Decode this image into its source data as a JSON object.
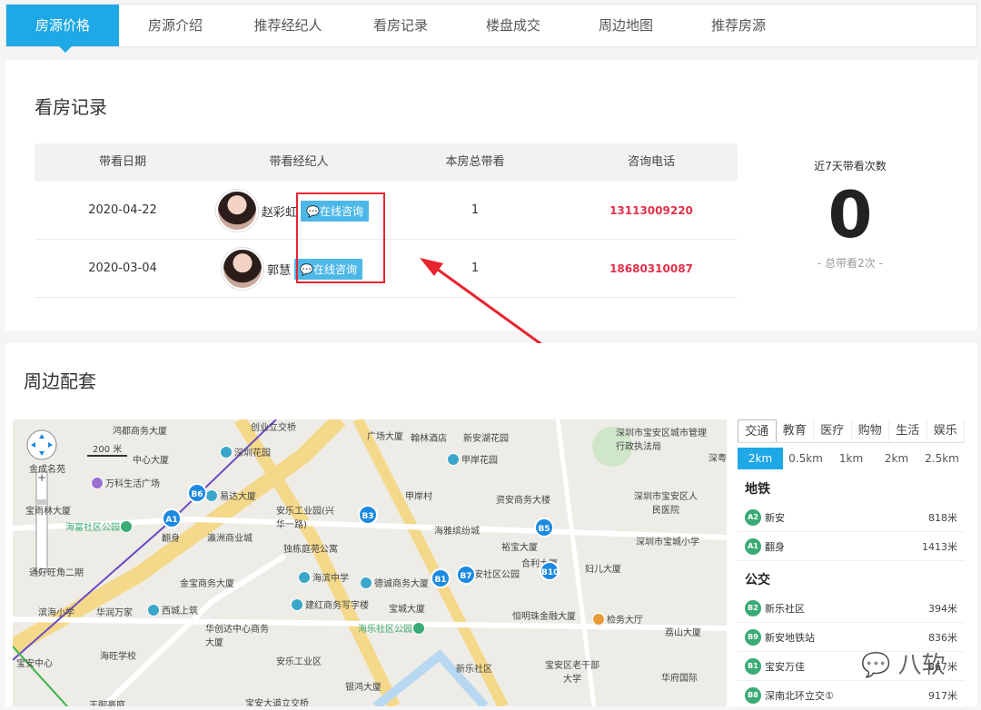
{
  "tabs": [
    "房源价格",
    "房源介绍",
    "推荐经纪人",
    "看房记录",
    "楼盘成交",
    "周边地图",
    "推荐房源"
  ],
  "viewing": {
    "title": "看房记录",
    "headers": [
      "带看日期",
      "带看经纪人",
      "本房总带看",
      "咨询电话"
    ],
    "rows": [
      {
        "date": "2020-04-22",
        "agent": "赵彩虹",
        "count": "1",
        "phone": "13113009220"
      },
      {
        "date": "2020-03-04",
        "agent": "郭慧",
        "count": "1",
        "phone": "18680310087"
      }
    ],
    "consult_label": "在线咨询",
    "stats": {
      "label": "近7天带看次数",
      "value": "0",
      "sub": "- 总带看2次 -"
    }
  },
  "nearby": {
    "title": "周边配套",
    "map": {
      "scale_label": "200 米",
      "pois": [
        "鸿都商务大厦",
        "创业立交桥",
        "广场大厦",
        "翰林酒店",
        "新安湖花园",
        "深圳市宝安区城市管理行政执法局",
        "深圳花园",
        "中心大厦",
        "金成名苑",
        "甲岸花园",
        "万科生活广场",
        "易达大厦",
        "甲岸村",
        "资安商务大楼",
        "深圳市宝安区人民医院",
        "宝雨林大厦",
        "安乐工业园(兴华一路)",
        "海雅缤纷城",
        "海富社区公园",
        "翻身",
        "瀛洲商业城",
        "独栋庭苑公寓",
        "裕宝大厦",
        "深圳市宝城小学",
        "合利大厦",
        "通好旺角二期",
        "妇儿大厦",
        "金宝商务大厦",
        "海滨中学",
        "德诚商务大厦",
        "新安社区公园",
        "滨海小学",
        "华润万家",
        "西城上筑",
        "建红商务写字楼",
        "宝城大厦",
        "恒明珠金融大厦",
        "检务大厅",
        "华创达中心商务大厦",
        "海乐社区公园",
        "荔山大厦",
        "海旺学校",
        "安乐工业区",
        "新乐社区",
        "宝安区老干部大学",
        "华府国际",
        "宝安中心",
        "银鸿大厦",
        "王御豪庭",
        "宝安大道立交桥",
        "深粤"
      ]
    },
    "tabs": [
      "交通",
      "教育",
      "医疗",
      "购物",
      "生活",
      "娱乐"
    ],
    "distances": [
      "2km",
      "0.5km",
      "1km",
      "2km",
      "2.5km"
    ],
    "metro_title": "地铁",
    "metro": [
      {
        "code": "A2",
        "name": "新安",
        "dist": "818米"
      },
      {
        "code": "A1",
        "name": "翻身",
        "dist": "1413米"
      }
    ],
    "bus_title": "公交",
    "bus": [
      {
        "code": "B2",
        "name": "新乐社区",
        "dist": "394米"
      },
      {
        "code": "B9",
        "name": "新安地铁站",
        "dist": "836米"
      },
      {
        "code": "B1",
        "name": "宝安万佳",
        "dist": "867米"
      },
      {
        "code": "B8",
        "name": "深南北环立交①",
        "dist": "917米"
      }
    ]
  },
  "watermark": "八软"
}
